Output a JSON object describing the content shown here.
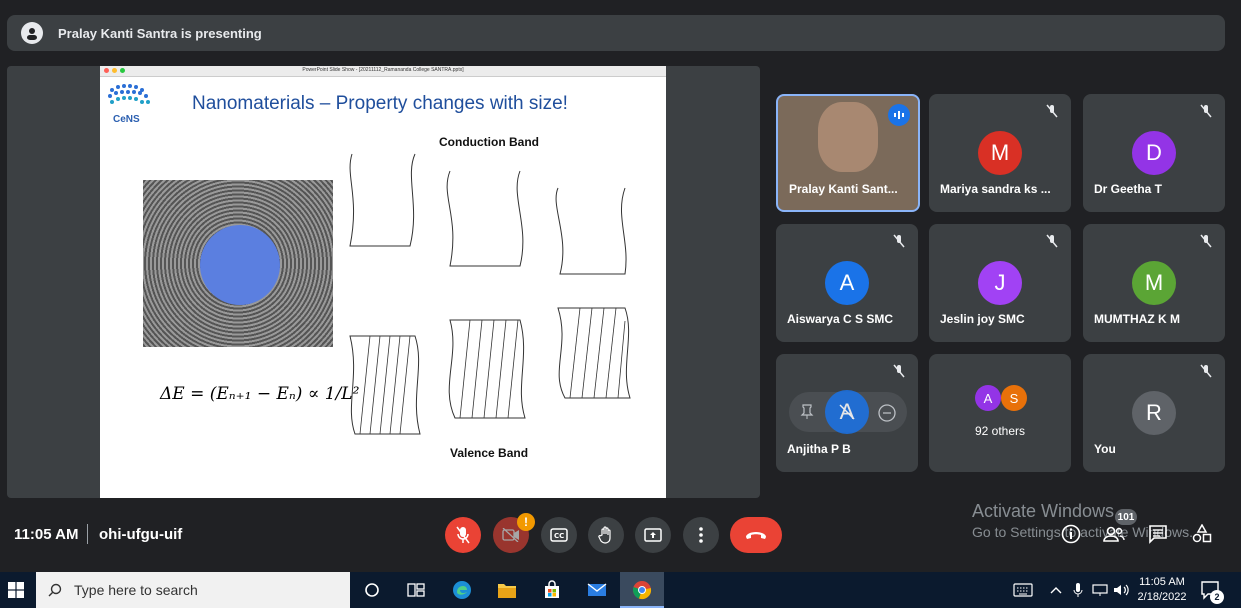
{
  "presenting_banner": {
    "text": "Pralay Kanti Santra is presenting"
  },
  "slide": {
    "window_title": "PowerPoint Slide Show - [20211112_Ramananda College SANTRA.pptx]",
    "logo_text": "CeNS",
    "title": "Nanomaterials – Property changes with size!",
    "conduction_label": "Conduction Band",
    "valence_label": "Valence Band",
    "formula_text": "ΔE = (Eₙ₊₁ − Eₙ) ∝ 1/L²"
  },
  "participants": [
    {
      "name": "Pralay Kanti Sant...",
      "type": "video",
      "speaking": true
    },
    {
      "name": "Mariya sandra ks ...",
      "initial": "M",
      "color": "#d93025"
    },
    {
      "name": "Dr Geetha T",
      "initial": "D",
      "color": "#9334e6"
    },
    {
      "name": "Aiswarya C S SMC",
      "initial": "A",
      "color": "#1a73e8"
    },
    {
      "name": "Jeslin joy SMC",
      "initial": "J",
      "color": "#a142f4"
    },
    {
      "name": "MUMTHAZ K M",
      "initial": "M",
      "color": "#5ba535"
    },
    {
      "name": "Anjitha P B",
      "initial": "A",
      "color": "#1a73e8"
    },
    {
      "name": "92 others",
      "initials": [
        "A",
        "S"
      ],
      "colors": [
        "#9334e6",
        "#e8710a"
      ]
    },
    {
      "name": "You",
      "initial": "R",
      "color": "#5f6368"
    }
  ],
  "meeting": {
    "time": "11:05 AM",
    "code": "ohi-ufgu-uif",
    "alert_badge": "!",
    "people_count": "101"
  },
  "watermark": {
    "line1": "Activate Windows",
    "line2": "Go to Settings to activate Windows."
  },
  "taskbar": {
    "search_placeholder": "Type here to search",
    "clock_time": "11:05 AM",
    "clock_date": "2/18/2022",
    "notification_count": "2"
  }
}
